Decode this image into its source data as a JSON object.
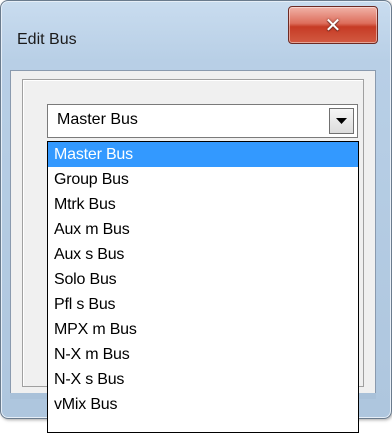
{
  "window": {
    "title": "Edit Bus",
    "close_glyph": "✕"
  },
  "bus_select": {
    "value": "Master Bus",
    "options": [
      "Master Bus",
      "Group Bus",
      "Mtrk Bus",
      "Aux m Bus",
      "Aux s Bus",
      "Solo Bus",
      "Pfl s Bus",
      "MPX m Bus",
      "N-X m Bus",
      "N-X s Bus",
      "vMix Bus"
    ],
    "selected_index": 0
  },
  "colors": {
    "highlight": "#3399ff",
    "close_button": "#c63b25",
    "frame": "#b8cfe6"
  },
  "icons": {
    "close": "close-icon",
    "dropdown_arrow": "chevron-down-icon"
  }
}
